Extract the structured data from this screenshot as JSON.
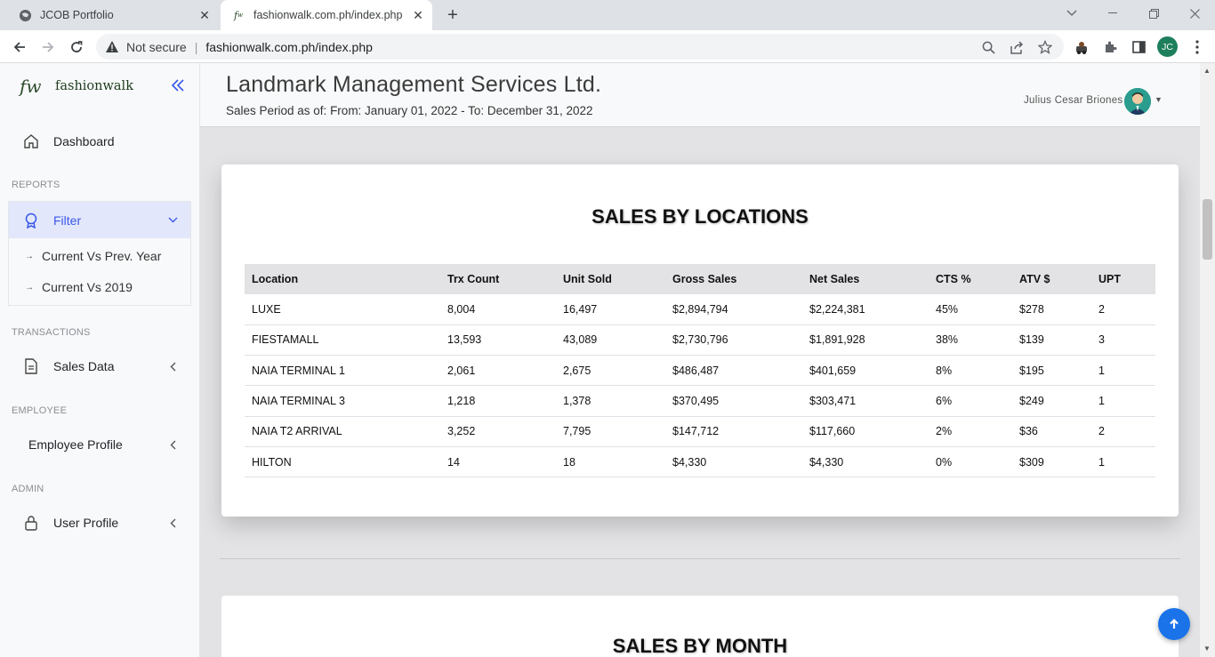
{
  "browser": {
    "tabs": [
      {
        "title": "JCOB Portfolio",
        "active": false,
        "icon": "globe-icon"
      },
      {
        "title": "fashionwalk.com.ph/index.php",
        "active": true,
        "icon": "fw-favicon"
      }
    ],
    "security_label": "Not secure",
    "url": "fashionwalk.com.ph/index.php",
    "profile_initials": "JC"
  },
  "sidebar": {
    "brand_logo": "fw",
    "brand_name": "fashionwalk",
    "dashboard": "Dashboard",
    "reports_section": "REPORTS",
    "filter": "Filter",
    "filter_items": [
      "Current Vs Prev. Year",
      "Current Vs 2019"
    ],
    "transactions_section": "TRANSACTIONS",
    "sales_data": "Sales Data",
    "employee_section": "EMPLOYEE",
    "employee_profile": "Employee Profile",
    "admin_section": "ADMIN",
    "user_profile": "User Profile"
  },
  "header": {
    "company": "Landmark Management Services Ltd.",
    "period": "Sales Period as of: From: January 01, 2022 - To: December 31, 2022",
    "user_name": "Julius Cesar Briones"
  },
  "sales_by_locations": {
    "title": "SALES BY LOCATIONS",
    "columns": [
      "Location",
      "Trx Count",
      "Unit Sold",
      "Gross Sales",
      "Net Sales",
      "CTS %",
      "ATV $",
      "UPT"
    ],
    "rows": [
      [
        "LUXE",
        "8,004",
        "16,497",
        "$2,894,794",
        "$2,224,381",
        "45%",
        "$278",
        "2"
      ],
      [
        "FIESTAMALL",
        "13,593",
        "43,089",
        "$2,730,796",
        "$1,891,928",
        "38%",
        "$139",
        "3"
      ],
      [
        "NAIA TERMINAL 1",
        "2,061",
        "2,675",
        "$486,487",
        "$401,659",
        "8%",
        "$195",
        "1"
      ],
      [
        "NAIA TERMINAL 3",
        "1,218",
        "1,378",
        "$370,495",
        "$303,471",
        "6%",
        "$249",
        "1"
      ],
      [
        "NAIA T2 ARRIVAL",
        "3,252",
        "7,795",
        "$147,712",
        "$117,660",
        "2%",
        "$36",
        "2"
      ],
      [
        "HILTON",
        "14",
        "18",
        "$4,330",
        "$4,330",
        "0%",
        "$309",
        "1"
      ]
    ]
  },
  "sales_by_month": {
    "title": "SALES BY MONTH"
  },
  "colors": {
    "accent": "#3a57e8",
    "scroll_top_button": "#1a73e8"
  }
}
